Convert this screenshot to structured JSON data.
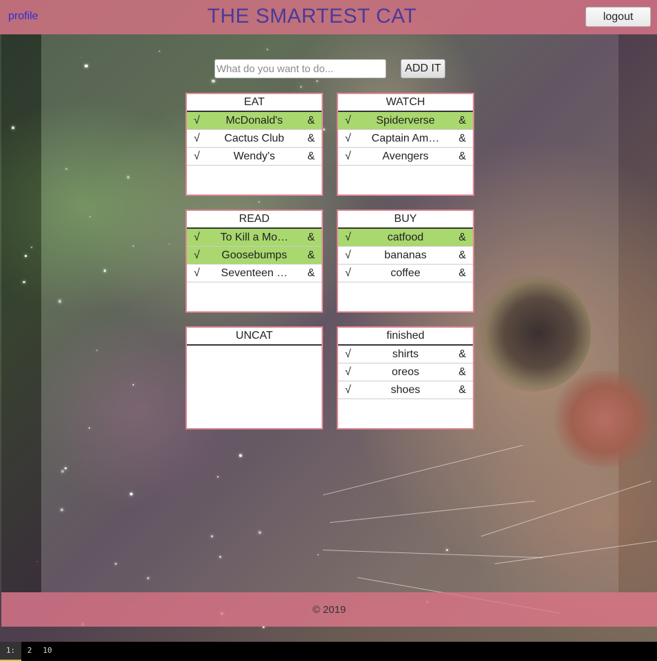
{
  "header": {
    "profile_link": "profile",
    "title": "THE SMARTEST CAT",
    "logout_label": "logout"
  },
  "add_bar": {
    "placeholder": "What do you want to do...",
    "button_label": "ADD IT"
  },
  "lists": [
    {
      "title": "EAT",
      "items": [
        {
          "check": "√",
          "label": "McDonald's",
          "action": "&",
          "done": true
        },
        {
          "check": "√",
          "label": "Cactus Club",
          "action": "&",
          "done": false
        },
        {
          "check": "√",
          "label": "Wendy's",
          "action": "&",
          "done": false
        }
      ]
    },
    {
      "title": "WATCH",
      "items": [
        {
          "check": "√",
          "label": "Spiderverse",
          "action": "&",
          "done": true
        },
        {
          "check": "√",
          "label": "Captain Am…",
          "action": "&",
          "done": false
        },
        {
          "check": "√",
          "label": "Avengers",
          "action": "&",
          "done": false
        }
      ]
    },
    {
      "title": "READ",
      "items": [
        {
          "check": "√",
          "label": "To Kill a Mo…",
          "action": "&",
          "done": true
        },
        {
          "check": "√",
          "label": "Goosebumps",
          "action": "&",
          "done": true
        },
        {
          "check": "√",
          "label": "Seventeen …",
          "action": "&",
          "done": false
        }
      ]
    },
    {
      "title": "BUY",
      "items": [
        {
          "check": "√",
          "label": "catfood",
          "action": "&",
          "done": true
        },
        {
          "check": "√",
          "label": "bananas",
          "action": "&",
          "done": false
        },
        {
          "check": "√",
          "label": "coffee",
          "action": "&",
          "done": false
        }
      ]
    },
    {
      "title": "UNCAT",
      "items": []
    },
    {
      "title": "finished",
      "items": [
        {
          "check": "√",
          "label": "shirts",
          "action": "&",
          "done": false
        },
        {
          "check": "√",
          "label": "oreos",
          "action": "&",
          "done": false
        },
        {
          "check": "√",
          "label": "shoes",
          "action": "&",
          "done": false
        }
      ]
    }
  ],
  "footer": {
    "copyright": "© 2019"
  },
  "taskbar": {
    "workspaces": [
      "1:",
      "2",
      "10"
    ],
    "active_index": 0
  },
  "colors": {
    "header_bg": "#e2788c",
    "done_row": "#a9d86e",
    "card_border": "#e28a97",
    "title": "#4a3a9a"
  }
}
